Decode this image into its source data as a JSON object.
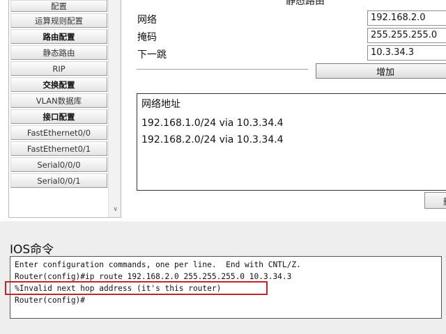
{
  "sidebar": {
    "items": [
      {
        "label": "配置",
        "type": "item"
      },
      {
        "label": "运算规则配置",
        "type": "item"
      },
      {
        "label": "路由配置",
        "type": "section"
      },
      {
        "label": "静态路由",
        "type": "item"
      },
      {
        "label": "RIP",
        "type": "item"
      },
      {
        "label": "交换配置",
        "type": "section"
      },
      {
        "label": "VLAN数据库",
        "type": "item"
      },
      {
        "label": "接口配置",
        "type": "section"
      },
      {
        "label": "FastEthernet0/0",
        "type": "item"
      },
      {
        "label": "FastEthernet0/1",
        "type": "item"
      },
      {
        "label": "Serial0/0/0",
        "type": "item"
      },
      {
        "label": "Serial0/0/1",
        "type": "item"
      }
    ]
  },
  "static_route": {
    "title": "静态路由",
    "network_label": "网络",
    "network_value": "192.168.2.0",
    "mask_label": "掩码",
    "mask_value": "255.255.255.0",
    "nexthop_label": "下一跳",
    "nexthop_value": "10.3.34.3",
    "add_button": "增加",
    "table_header": "网络地址",
    "routes": [
      "192.168.1.0/24 via 10.3.34.4",
      "192.168.2.0/24 via 10.3.34.4"
    ],
    "cut_button": "删"
  },
  "ios": {
    "title": "IOS命令",
    "lines": [
      "Enter configuration commands, one per line.  End with CNTL/Z.",
      "Router(config)#ip route 192.168.2.0 255.255.255.0 10.3.34.3",
      "%Invalid next hop address (it's this router)",
      "Router(config)#"
    ]
  },
  "colors": {
    "highlight": "#c0252a",
    "band": "#eeeeee"
  }
}
